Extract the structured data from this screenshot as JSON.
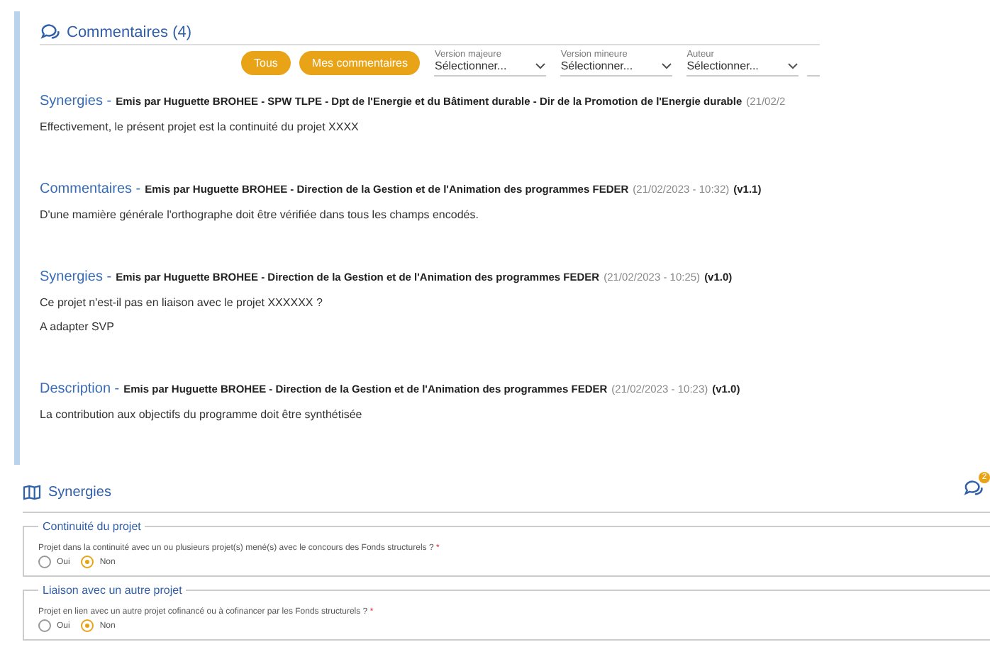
{
  "comments_panel": {
    "title": "Commentaires (4)",
    "filter_buttons": [
      {
        "label": "Tous",
        "selected": true
      },
      {
        "label": "Mes commentaires",
        "selected": true
      }
    ],
    "filters": [
      {
        "label": "Version majeure",
        "value": "Sélectionner..."
      },
      {
        "label": "Version mineure",
        "value": "Sélectionner..."
      },
      {
        "label": "Auteur",
        "value": "Sélectionner..."
      }
    ],
    "comments": [
      {
        "section": "Synergies -",
        "author": "Emis par Huguette BROHEE - SPW TLPE - Dpt de l'Energie et du Bâtiment durable - Dir de la Promotion de l'Energie durable",
        "date": "(21/02/2",
        "lines": [
          "Effectivement, le présent projet est la continuité du projet XXXX"
        ]
      },
      {
        "section": "Commentaires -",
        "author": "Emis par Huguette BROHEE - Direction de la Gestion et de l'Animation des programmes FEDER",
        "date": "(21/02/2023 - 10:32)",
        "version": "(v1.1)",
        "lines": [
          "D'une mamière générale l'orthographe doit être vérifiée dans tous les champs encodés."
        ]
      },
      {
        "section": "Synergies -",
        "author": "Emis par Huguette BROHEE - Direction de la Gestion et de l'Animation des programmes FEDER",
        "date": "(21/02/2023 - 10:25)",
        "version": "(v1.0)",
        "lines": [
          "Ce projet n'est-il pas en liaison avec le projet XXXXXX ?",
          "A adapter SVP"
        ]
      },
      {
        "section": "Description -",
        "author": "Emis par Huguette BROHEE - Direction de la Gestion et de l'Animation des programmes FEDER",
        "date": "(21/02/2023 - 10:23)",
        "version": "(v1.0)",
        "lines": [
          "La contribution aux objectifs du programme doit être synthétisée"
        ]
      }
    ]
  },
  "section": {
    "title": "Synergies",
    "comment_badge": "2",
    "groups": [
      {
        "legend": "Continuité du projet",
        "question": "Projet dans la continuité avec un ou plusieurs projet(s) mené(s) avec le concours des Fonds structurels ?",
        "required": "*",
        "options": [
          {
            "label": "Oui",
            "selected": false
          },
          {
            "label": "Non",
            "selected": true
          }
        ]
      },
      {
        "legend": "Liaison avec un autre projet",
        "question": "Projet en lien avec un autre projet cofinancé ou à cofinancer par les Fonds structurels ?",
        "required": "*",
        "options": [
          {
            "label": "Oui",
            "selected": false
          },
          {
            "label": "Non",
            "selected": true
          }
        ]
      }
    ]
  }
}
